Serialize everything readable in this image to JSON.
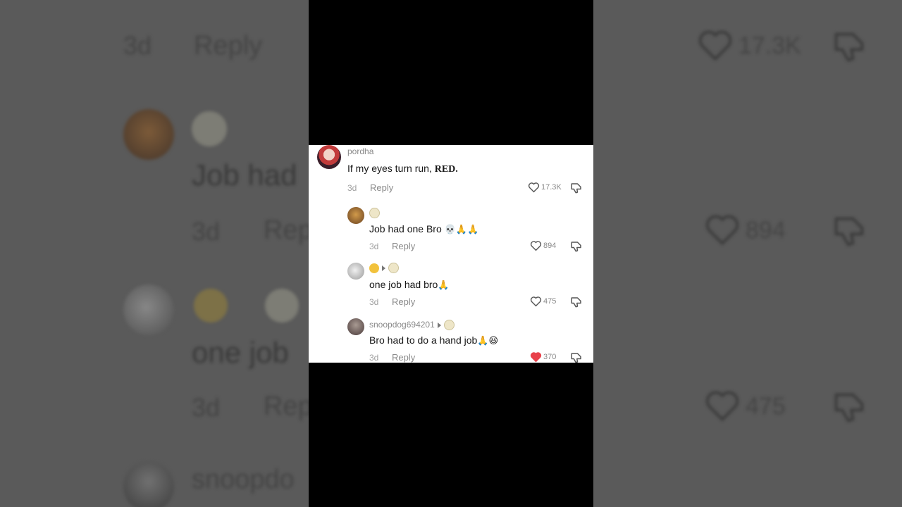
{
  "comments": [
    {
      "username": "pordha",
      "text_plain": "If my eyes turn run, ",
      "text_bold": "RED.",
      "age": "3d",
      "reply_label": "Reply",
      "likes": "17.3K",
      "liked": false
    },
    {
      "username": "",
      "text": "Job had one Bro",
      "emojis": "💀🙏🙏",
      "age": "3d",
      "reply_label": "Reply",
      "likes": "894",
      "liked": false
    },
    {
      "username": "",
      "text": "one job had bro",
      "emojis": "🙏",
      "age": "3d",
      "reply_label": "Reply",
      "likes": "475",
      "liked": false
    },
    {
      "username": "snoopdog694201",
      "text": "Bro had to do a hand job",
      "emojis": "🙏😆",
      "age": "3d",
      "reply_label": "Reply",
      "likes": "370",
      "liked": true
    }
  ],
  "background": {
    "age_1": "3d",
    "reply_1": "Reply",
    "likes_1": "17.3K",
    "text_2": "Job had",
    "age_2": "3d",
    "reply_2": "Reply",
    "likes_2": "894",
    "text_3": "one job",
    "age_3": "3d",
    "reply_3": "Rep",
    "likes_3": "475",
    "text_4": "snoopdo"
  },
  "colors": {
    "liked_heart": "#e8414a",
    "username": "#8a8a8a",
    "text": "#161616"
  },
  "icons": [
    "heart-icon",
    "thumbs-down-icon",
    "neutral-face-emoji",
    "confused-face-emoji",
    "play-triangle-icon"
  ]
}
